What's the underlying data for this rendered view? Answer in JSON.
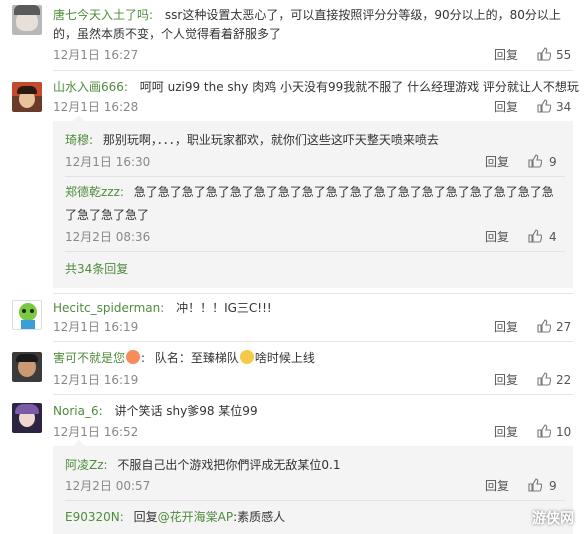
{
  "actions": {
    "reply": "回复"
  },
  "comments": [
    {
      "user": "唐七今天入土了吗",
      "line1": "ssr这种设置太恶心了，可以直接按照评分分等级，90分以上的，80分以上",
      "line2": "的，虽然本质不变，个人觉得看着舒服多了",
      "time": "12月1日 16:27",
      "likes": "55"
    },
    {
      "user": "山水入画666",
      "text": "呵呵 uzi99 the shy 肉鸡 小天没有99我就不服了 什么经理游戏 评分就让人不想玩",
      "time": "12月1日 16:28",
      "likes": "34",
      "replies": [
        {
          "user": "琦穆",
          "text": "那别玩啊，．．．，职业玩家都欢，就你们这些这吓天整天喷来喷去",
          "time": "12月1日 16:30",
          "likes": "9"
        },
        {
          "user": "郑德乾zzz",
          "line1": "急了急了急了急了急了急了急了急了急了急了急了急了急了急了急了急了急了急",
          "line2": "了急了急了急了",
          "time": "12月2日 08:36",
          "likes": "4"
        }
      ],
      "more": "共34条回复"
    },
    {
      "user": "Hecitc_spiderman",
      "text": "冲！！！IG三C!!!",
      "time": "12月1日 16:19",
      "likes": "27"
    },
    {
      "user": "害可不就是您",
      "text_a": "队名：至臻梯队",
      "text_b": "啥时候上线",
      "time": "12月1日 16:19",
      "likes": "22"
    },
    {
      "user": "Noria_6",
      "text": "讲个笑话 shy爹98 某位99",
      "time": "12月1日 16:52",
      "likes": "10",
      "replies": [
        {
          "user": "阿凌Zz",
          "text": "不服自己出个游戏把你們评成无敌某位0.1",
          "time": "12月2日 00:57",
          "likes": "9"
        },
        {
          "user": "E90320N",
          "prefix": "回复",
          "mention": "@花开海棠AP",
          "text": ":素质感人"
        }
      ]
    }
  ],
  "watermark": "游侠网"
}
